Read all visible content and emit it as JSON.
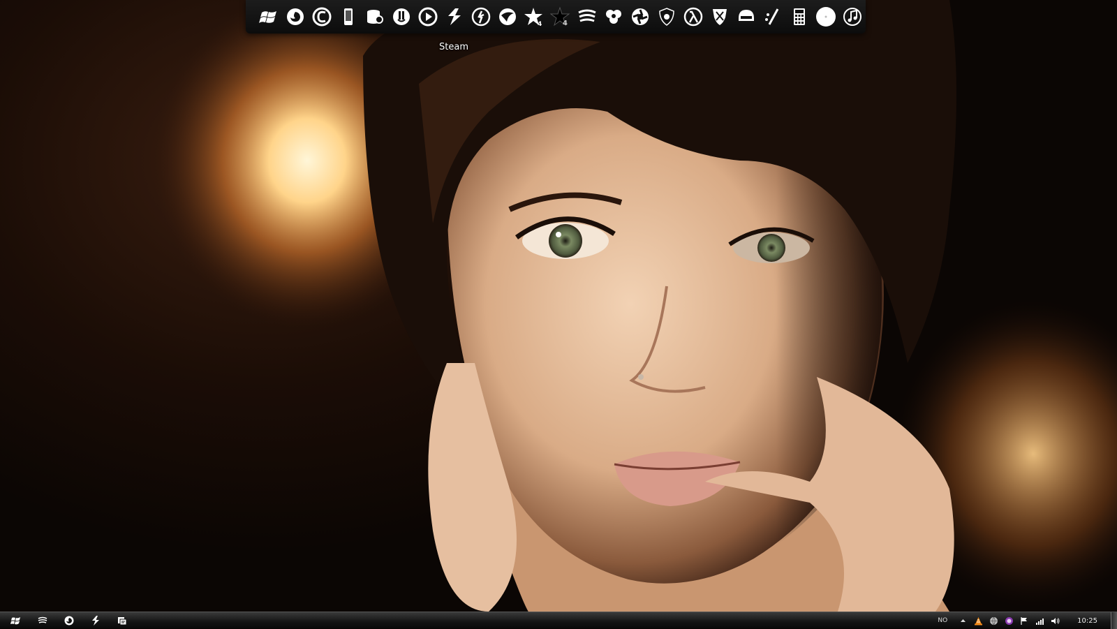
{
  "desktop": {
    "wallpaper": "portrait-photo",
    "accent_colors": {
      "glow": "#ffd28a",
      "skin": "#e8c2a0",
      "hair": "#1a0f0a",
      "dock_bg": "#111111"
    }
  },
  "dock": {
    "tooltip": "Steam",
    "items": [
      {
        "icon": "windows-logo-icon"
      },
      {
        "icon": "firefox-icon"
      },
      {
        "icon": "utorrent-c-icon"
      },
      {
        "icon": "device-icon"
      },
      {
        "icon": "database-search-icon"
      },
      {
        "icon": "power-shield-icon"
      },
      {
        "icon": "media-player-icon"
      },
      {
        "icon": "steam-icon"
      },
      {
        "icon": "counter-strike-icon"
      },
      {
        "icon": "league-icon"
      },
      {
        "icon": "star-4-icon"
      },
      {
        "icon": "star-4-dark-icon"
      },
      {
        "icon": "wifi-stripes-icon"
      },
      {
        "icon": "clover-icon"
      },
      {
        "icon": "aperture-icon"
      },
      {
        "icon": "shield-bug-icon"
      },
      {
        "icon": "half-life-lambda-icon"
      },
      {
        "icon": "crest-icon"
      },
      {
        "icon": "helmet-icon"
      },
      {
        "icon": "slash-tool-icon"
      },
      {
        "icon": "calculator-icon"
      },
      {
        "icon": "disc-icon"
      },
      {
        "icon": "music-note-icon"
      }
    ]
  },
  "taskbar": {
    "pinned": [
      {
        "icon": "start-windows-icon"
      },
      {
        "icon": "wifi-stripes-icon"
      },
      {
        "icon": "firefox-icon"
      },
      {
        "icon": "steam-icon"
      },
      {
        "icon": "windows-explorer-icon"
      }
    ],
    "tray": {
      "language": "NO",
      "icons": [
        "show-hidden-arrow-icon",
        "vlc-cone-icon",
        "network-globe-icon",
        "shield-color-icon",
        "action-flag-icon",
        "signal-bars-icon",
        "speaker-icon"
      ],
      "clock": "10:25"
    }
  }
}
